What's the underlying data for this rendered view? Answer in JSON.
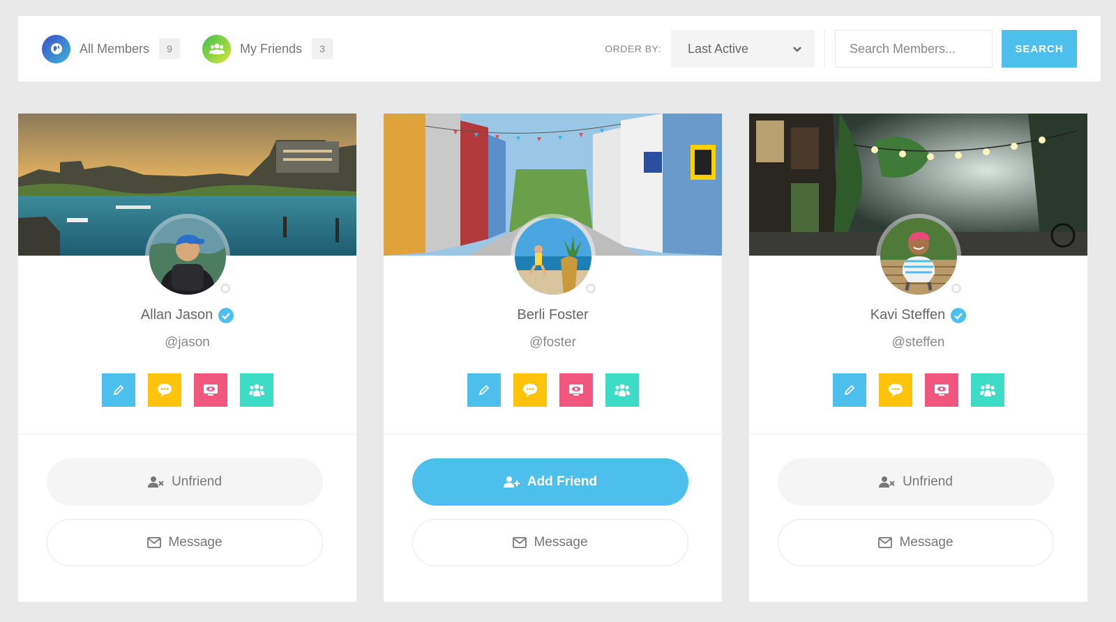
{
  "filters": {
    "all_members": {
      "label": "All Members",
      "count": "9",
      "icon": "globe-icon",
      "gradient": [
        "#3a4fc9",
        "#3fb5d6"
      ]
    },
    "my_friends": {
      "label": "My Friends",
      "count": "3",
      "icon": "group-icon",
      "gradient": [
        "#3fbf4f",
        "#d6e63a"
      ]
    }
  },
  "order_by": {
    "label": "ORDER BY:",
    "selected": "Last Active"
  },
  "search": {
    "placeholder": "Search Members...",
    "button": "SEARCH"
  },
  "colors": {
    "accent": "#4dbfec",
    "edit": "#4dbfec",
    "message_action": "#ffc30b",
    "view": "#f1567f",
    "groups": "#3ddcc6"
  },
  "members": [
    {
      "name": "Allan Jason",
      "handle": "@jason",
      "verified": true,
      "cover": "river-city-sunset",
      "friend_button": {
        "label": "Unfriend",
        "type": "unfriend",
        "icon": "user-remove-icon"
      },
      "message_button": {
        "label": "Message",
        "icon": "envelope-icon"
      }
    },
    {
      "name": "Berli Foster",
      "handle": "@foster",
      "verified": false,
      "cover": "colorful-street",
      "friend_button": {
        "label": "Add Friend",
        "type": "add",
        "icon": "user-add-icon"
      },
      "message_button": {
        "label": "Message",
        "icon": "envelope-icon"
      }
    },
    {
      "name": "Kavi Steffen",
      "handle": "@steffen",
      "verified": true,
      "cover": "night-alley-lanterns",
      "friend_button": {
        "label": "Unfriend",
        "type": "unfriend",
        "icon": "user-remove-icon"
      },
      "message_button": {
        "label": "Message",
        "icon": "envelope-icon"
      }
    }
  ]
}
